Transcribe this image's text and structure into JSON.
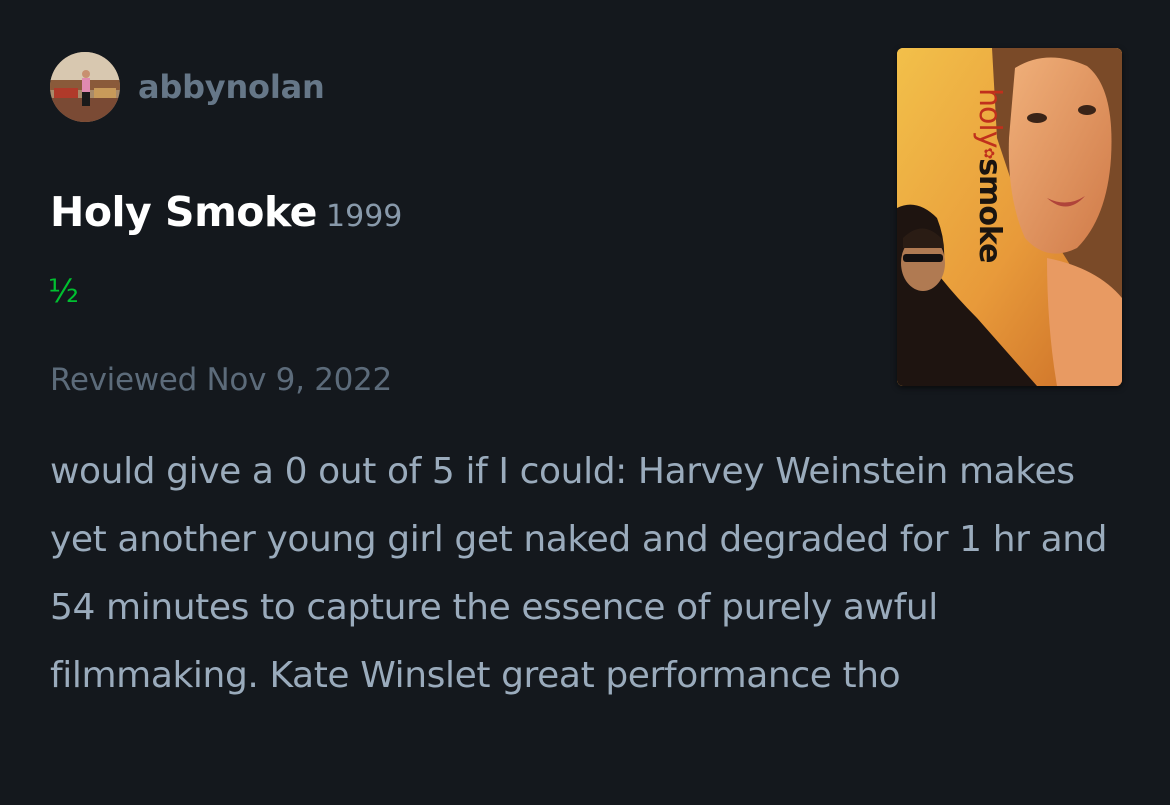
{
  "author": {
    "username": "abbynolan"
  },
  "film": {
    "title": "Holy Smoke",
    "year": "1999",
    "poster_title_part1": "holy",
    "poster_title_sep": "✿",
    "poster_title_part2": "smoke"
  },
  "rating": {
    "display": "½",
    "stars": 0.5,
    "max": 5
  },
  "review": {
    "date_label": "Reviewed Nov 9, 2022",
    "body": "would give a 0 out of 5 if I could: Harvey Weinstein makes yet another young girl get naked and degraded for 1 hr and 54 minutes to capture the essence of purely awful filmmaking. Kate Winslet great performance tho"
  },
  "colors": {
    "background": "#14181d",
    "title": "#ffffff",
    "rating_green": "#00c030",
    "body_text": "#9aabbc",
    "muted_text": "#5c6b7a"
  }
}
